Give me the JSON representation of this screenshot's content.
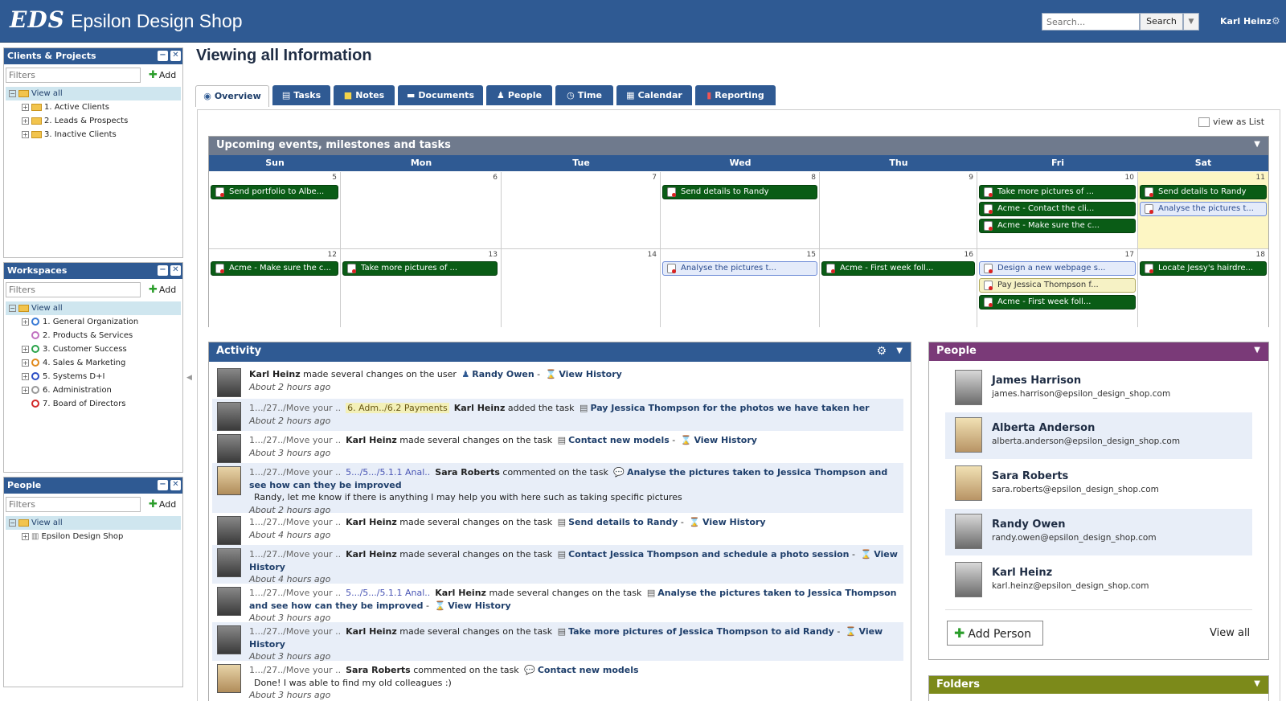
{
  "header": {
    "logo": "EDS",
    "app_name": "Epsilon Design Shop",
    "search_placeholder": "Search...",
    "search_button": "Search",
    "user": "Karl Heinz"
  },
  "sidebar": {
    "clients": {
      "title": "Clients & Projects",
      "filter_placeholder": "Filters",
      "add": "Add",
      "root": "View all",
      "items": [
        "1. Active Clients",
        "2. Leads & Prospects",
        "3. Inactive Clients"
      ]
    },
    "workspaces": {
      "title": "Workspaces",
      "filter_placeholder": "Filters",
      "add": "Add",
      "root": "View all",
      "items": [
        "1. General Organization",
        "2. Products & Services",
        "3. Customer Success",
        "4. Sales & Marketing",
        "5. Systems D+I",
        "6. Administration",
        "7. Board of Directors"
      ],
      "colors": [
        "#3a7bd5",
        "#c070c0",
        "#2aa34a",
        "#e08a1e",
        "#2c4ec5",
        "#999999",
        "#d22a2a"
      ]
    },
    "people": {
      "title": "People",
      "filter_placeholder": "Filters",
      "add": "Add",
      "root": "View all",
      "items": [
        "Epsilon Design Shop"
      ]
    }
  },
  "page": {
    "title": "Viewing all Information",
    "view_as_list": "view as List"
  },
  "tabs": [
    "Overview",
    "Tasks",
    "Notes",
    "Documents",
    "People",
    "Time",
    "Calendar",
    "Reporting"
  ],
  "calendar": {
    "title": "Upcoming events, milestones and tasks",
    "days": [
      "Sun",
      "Mon",
      "Tue",
      "Wed",
      "Thu",
      "Fri",
      "Sat"
    ],
    "week1": {
      "nums": [
        "5",
        "6",
        "7",
        "8",
        "9",
        "10",
        "11"
      ]
    },
    "week2": {
      "nums": [
        "12",
        "13",
        "14",
        "15",
        "16",
        "17",
        "18"
      ]
    },
    "events": {
      "e1": "Send portfolio to Albe...",
      "e2": "Send details to Randy",
      "e3": "Take more pictures of ...",
      "e4": "Acme - Contact the cli...",
      "e5": "Acme - Make sure the c...",
      "e6": "Send details to Randy",
      "e7": "Analyse the pictures t...",
      "e8": "Acme - Make sure the c...",
      "e9": "Take more pictures of ...",
      "e10": "Analyse the pictures t...",
      "e11": "Acme - First week foll...",
      "e12": "Design a new webpage s...",
      "e13": "Pay Jessica Thompson f...",
      "e14": "Acme - First week foll...",
      "e15": "Locate Jessy's hairdre..."
    }
  },
  "activity": {
    "title": "Activity",
    "rows": [
      {
        "who": "Karl Heinz",
        "action": "made several changes on the user",
        "target": "Randy Owen",
        "link": "View History",
        "time": "About 2 hours ago"
      },
      {
        "crumb": "1.../27../Move your ..",
        "tag": "6. Adm../6.2 Payments",
        "who": "Karl Heinz",
        "action": "added the task",
        "target": "Pay Jessica Thompson for the photos we have taken her",
        "time": "About 2 hours ago"
      },
      {
        "crumb": "1.../27../Move your ..",
        "who": "Karl Heinz",
        "action": "made several changes on the task",
        "target": "Contact new models",
        "link": "View History",
        "time": "About 3 hours ago"
      },
      {
        "crumb": "1.../27../Move your ..",
        "crumb2": "5.../5.../5.1.1 Anal..",
        "who": "Sara Roberts",
        "action": "commented on the task",
        "target": "Analyse the pictures taken to Jessica Thompson and see how can they be improved",
        "comment": "Randy, let me know if there is anything I may help you with here such as taking specific pictures",
        "time": "About 2 hours ago"
      },
      {
        "crumb": "1.../27../Move your ..",
        "who": "Karl Heinz",
        "action": "made several changes on the task",
        "target": "Send details to Randy",
        "link": "View History",
        "time": "About 4 hours ago"
      },
      {
        "crumb": "1.../27../Move your ..",
        "who": "Karl Heinz",
        "action": "made several changes on the task",
        "target": "Contact Jessica Thompson and schedule a photo session",
        "link": "View History",
        "time": "About 4 hours ago"
      },
      {
        "crumb": "1.../27../Move your ..",
        "crumb2": "5.../5.../5.1.1 Anal..",
        "who": "Karl Heinz",
        "action": "made several changes on the task",
        "target": "Analyse the pictures taken to Jessica Thompson and see how can they be improved",
        "link": "View History",
        "time": "About 3 hours ago"
      },
      {
        "crumb": "1.../27../Move your ..",
        "who": "Karl Heinz",
        "action": "made several changes on the task",
        "target": "Take more pictures of Jessica Thompson to aid Randy",
        "link": "View History",
        "time": "About 3 hours ago"
      },
      {
        "crumb": "1.../27../Move your ..",
        "who": "Sara Roberts",
        "action": "commented on the task",
        "target": "Contact new models",
        "comment": "Done! I was able to find my old colleagues :)",
        "time": "About 3 hours ago"
      }
    ]
  },
  "people": {
    "title": "People",
    "list": [
      {
        "name": "James Harrison",
        "email": "james.harrison@epsilon_design_shop.com"
      },
      {
        "name": "Alberta Anderson",
        "email": "alberta.anderson@epsilon_design_shop.com"
      },
      {
        "name": "Sara Roberts",
        "email": "sara.roberts@epsilon_design_shop.com"
      },
      {
        "name": "Randy Owen",
        "email": "randy.owen@epsilon_design_shop.com"
      },
      {
        "name": "Karl Heinz",
        "email": "karl.heinz@epsilon_design_shop.com"
      }
    ],
    "add": "Add Person",
    "view_all": "View all"
  },
  "folders": {
    "title": "Folders"
  }
}
